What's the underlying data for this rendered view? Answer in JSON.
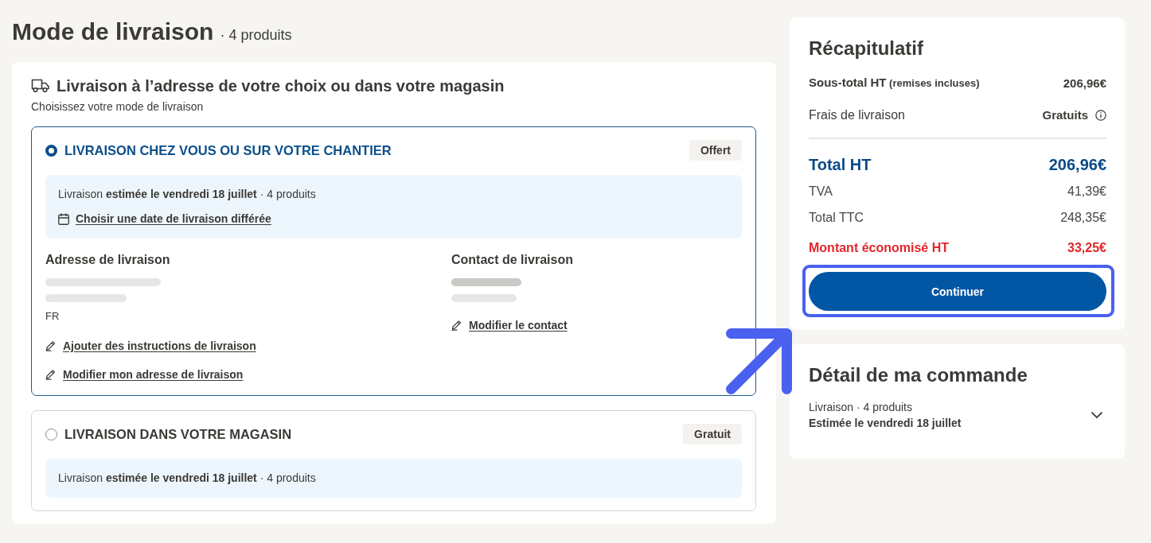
{
  "page": {
    "title": "Mode de livraison",
    "count": "· 4 produits"
  },
  "delivery": {
    "title": "Livraison à l’adresse de votre choix ou dans votre magasin",
    "subtitle": "Choisissez votre mode de livraison",
    "options": [
      {
        "title": "LIVRAISON CHEZ VOUS OU SUR VOTRE CHANTIER",
        "selected": true,
        "badge": "Offert",
        "estimate": "Livraison **estimée le vendredi 18 juillet** · 4 produits",
        "date_link": "Choisir une date de livraison différée",
        "address": {
          "heading": "Adresse de livraison",
          "lines": [
            {
              "redacted": true,
              "emphasis": false
            },
            {
              "redacted": true,
              "emphasis": false
            },
            {
              "redacted": false,
              "emphasis": false,
              "text": "FR"
            }
          ],
          "links": [
            "Ajouter des instructions de livraison",
            "Modifier mon adresse de livraison"
          ]
        },
        "contact": {
          "heading": "Contact de livraison",
          "lines": [
            {
              "redacted": true,
              "emphasis": true
            },
            {
              "redacted": true,
              "emphasis": false
            }
          ],
          "links": [
            "Modifier le contact"
          ]
        }
      },
      {
        "title": "LIVRAISON DANS VOTRE MAGASIN",
        "selected": false,
        "badge": "Gratuit",
        "estimate": "Livraison **estimée le vendredi 18 juillet** · 4 produits"
      }
    ]
  },
  "summary": {
    "title": "Récapitulatif",
    "rows": [
      {
        "kind": "subtotal",
        "label": "Sous-total HT",
        "note": "(remises incluses)",
        "value": "206,96€"
      },
      {
        "kind": "fee",
        "label": "Frais de livraison",
        "value": "Gratuits"
      },
      {
        "kind": "total",
        "label": "Total HT",
        "value": "206,96€"
      },
      {
        "kind": "line",
        "label": "TVA",
        "value": "41,39€"
      },
      {
        "kind": "line",
        "label": "Total TTC",
        "value": "248,35€"
      },
      {
        "kind": "savings",
        "label": "Montant économisé HT",
        "value": "33,25€"
      }
    ],
    "button": {
      "label": "Continuer",
      "highlighted": true
    }
  },
  "order_detail": {
    "title": "Détail de ma commande",
    "line": "Livraison · 4 produits",
    "estimate": "Estimée le vendredi 18 juillet",
    "expanded": false
  },
  "annotations": [
    {
      "kind": "arrow"
    }
  ]
}
